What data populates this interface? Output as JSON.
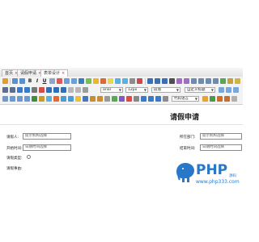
{
  "tabs": [
    {
      "label": "首页",
      "closable": true
    },
    {
      "label": "请假申请",
      "closable": true
    },
    {
      "label": "表单设计",
      "closable": true,
      "active": true
    }
  ],
  "toolbar": {
    "font_name": "arial",
    "font_size": "12px",
    "paragraph": "段落",
    "custom_title": "自定义标题",
    "code_language": "代码语言",
    "glyphs": {
      "bold": "B",
      "italic": "I",
      "underline": "U",
      "superscript": "x²",
      "subscript": "x₂"
    }
  },
  "document": {
    "title": "请假申请",
    "fields": {
      "applicant_label": "请假人:",
      "applicant_value": "提示机构选择",
      "department_label": "所在部门:",
      "department_value": "提示机构选择",
      "start_label": "开始时间:",
      "start_value": "日期时间选择",
      "end_label": "结束时间:",
      "end_value": "日期时间选择",
      "type_label": "请假类型:",
      "reason_label": "请假事由:"
    }
  },
  "watermark": {
    "brand": "PHP",
    "brand_cn": "源码",
    "url": "www.php333.com"
  },
  "colors": {
    "accent": "#2877c8",
    "tab_close": "#cc3333"
  }
}
